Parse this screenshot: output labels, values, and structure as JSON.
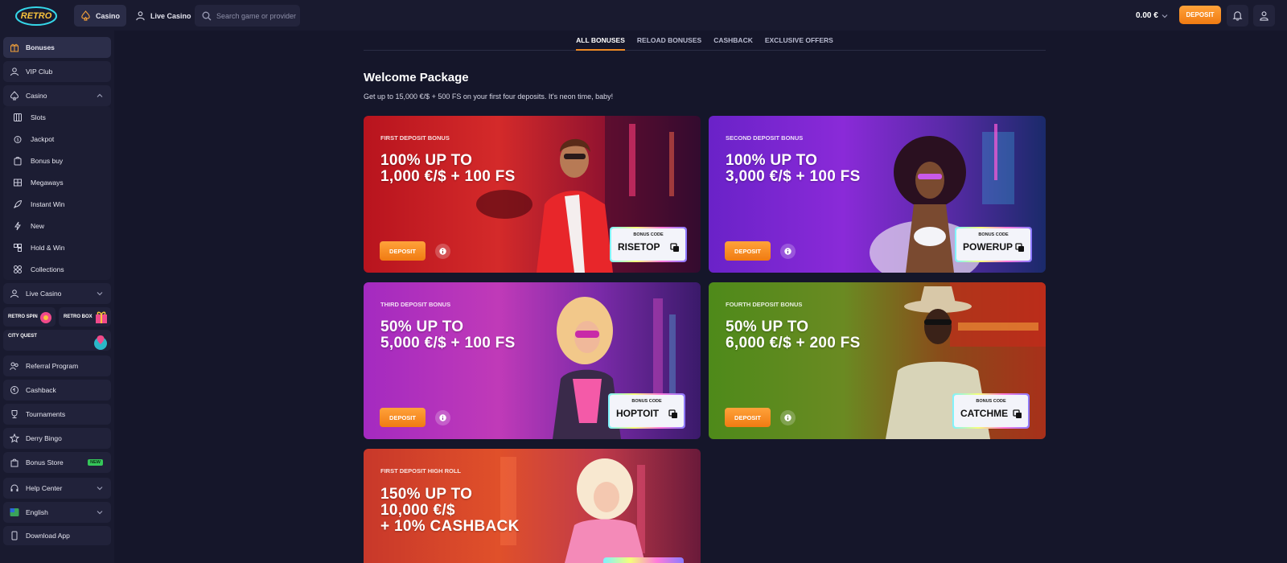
{
  "header": {
    "logo_text": "RETRO",
    "tabs": [
      {
        "label": "Casino",
        "icon": "spade-icon",
        "active": true
      },
      {
        "label": "Live Casino",
        "icon": "dealer-icon",
        "active": false
      }
    ],
    "search_placeholder": "Search game or provider",
    "balance": "0.00 €",
    "deposit_label": "DEPOSIT"
  },
  "sidebar": {
    "top_items": [
      {
        "label": "Bonuses",
        "icon": "gift-icon",
        "active": true
      },
      {
        "label": "VIP Club",
        "icon": "vip-icon"
      },
      {
        "label": "Casino",
        "icon": "spade-icon",
        "expanded": true
      }
    ],
    "casino_sub": [
      {
        "label": "Slots",
        "icon": "slots-icon"
      },
      {
        "label": "Jackpot",
        "icon": "jackpot-icon"
      },
      {
        "label": "Bonus buy",
        "icon": "bonus-buy-icon"
      },
      {
        "label": "Megaways",
        "icon": "megaways-icon"
      },
      {
        "label": "Instant Win",
        "icon": "rocket-icon"
      },
      {
        "label": "New",
        "icon": "lightning-icon"
      },
      {
        "label": "Hold & Win",
        "icon": "hold-win-icon"
      },
      {
        "label": "Collections",
        "icon": "collections-icon"
      }
    ],
    "live_casino": "Live Casino",
    "promos": {
      "retro_spin": "RETRO SPIN",
      "retro_box": "RETRO BOX",
      "city_quest": "CITY QUEST"
    },
    "bottom_items": [
      {
        "label": "Referral Program",
        "icon": "referral-icon"
      },
      {
        "label": "Cashback",
        "icon": "cashback-icon"
      },
      {
        "label": "Tournaments",
        "icon": "trophy-icon"
      },
      {
        "label": "Derry Bingo",
        "icon": "star-icon"
      },
      {
        "label": "Bonus Store",
        "icon": "store-icon",
        "badge": "NEW"
      }
    ],
    "help_center": "Help Center",
    "language": "English",
    "download_app": "Download App"
  },
  "bonus_tabs": [
    {
      "label": "ALL BONUSES",
      "active": true
    },
    {
      "label": "RELOAD BONUSES"
    },
    {
      "label": "CASHBACK"
    },
    {
      "label": "EXCLUSIVE OFFERS"
    }
  ],
  "welcome": {
    "title": "Welcome Package",
    "subtitle": "Get up to 15,000 €/$ + 500 FS on your first four deposits. It's neon time, baby!"
  },
  "cards": [
    {
      "label": "FIRST DEPOSIT BONUS",
      "line1": "100% UP TO",
      "line2": "1,000 €/$ + 100 FS",
      "code": "RISETOP",
      "color": "#c8202a"
    },
    {
      "label": "SECOND DEPOSIT BONUS",
      "line1": "100% UP TO",
      "line2": "3,000 €/$ + 100 FS",
      "code": "POWERUP",
      "color": "#7a2fd0"
    },
    {
      "label": "THIRD DEPOSIT BONUS",
      "line1": "50% UP TO",
      "line2": "5,000 €/$ + 100 FS",
      "code": "HOPTOIT",
      "color": "#b02fc0"
    },
    {
      "label": "FOURTH DEPOSIT BONUS",
      "line1": "50% UP TO",
      "line2": "6,000 €/$ + 200 FS",
      "code": "CATCHME",
      "color": "#5a8a1f"
    },
    {
      "label": "FIRST DEPOSIT HIGH ROLL",
      "line1": "150% UP TO",
      "line2": "10,000 €/$",
      "line3": "+ 10% CASHBACK",
      "color": "#d8492a"
    }
  ],
  "card_ui": {
    "deposit_label": "DEPOSIT",
    "bonus_code_label": "BONUS CODE"
  }
}
